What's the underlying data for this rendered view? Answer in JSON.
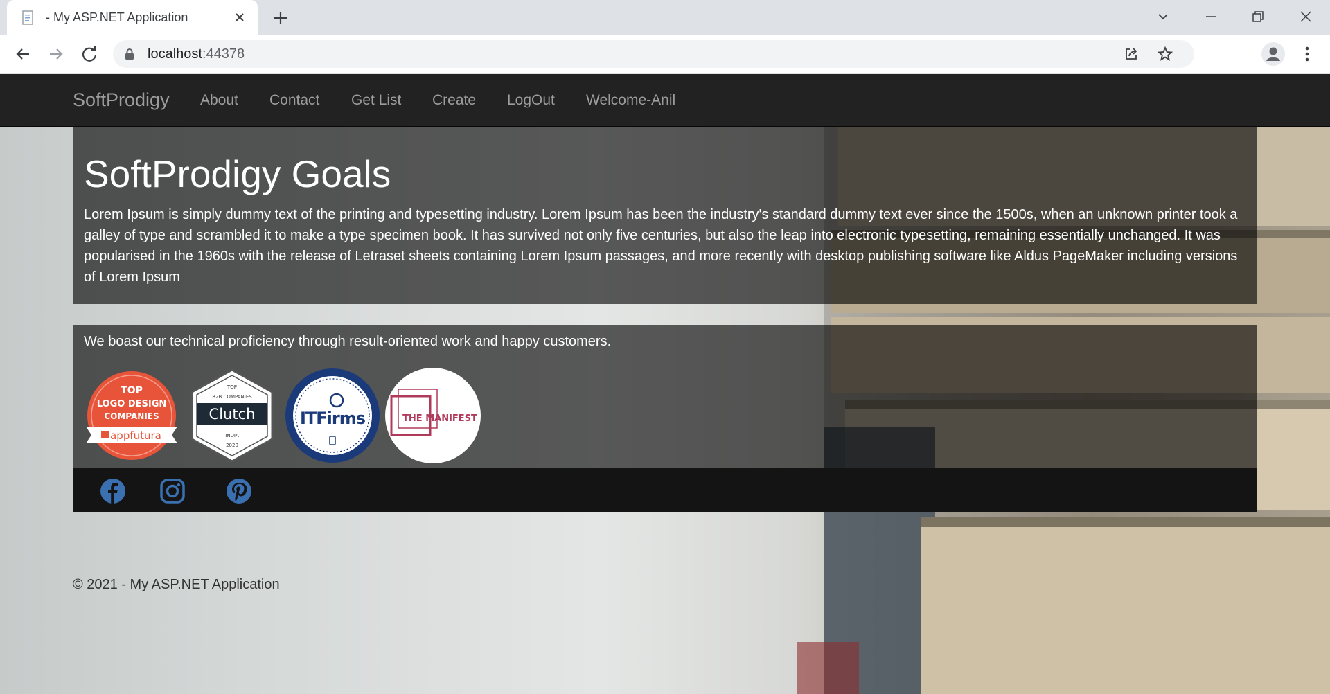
{
  "browser": {
    "tab_title": "- My ASP.NET Application",
    "url_host": "localhost",
    "url_port": ":44378"
  },
  "site": {
    "brand": "SoftProdigy",
    "nav": [
      {
        "label": "About"
      },
      {
        "label": "Contact"
      },
      {
        "label": "Get List"
      },
      {
        "label": "Create"
      },
      {
        "label": "LogOut"
      },
      {
        "label": "Welcome-Anil"
      }
    ]
  },
  "goals": {
    "title": "SoftProdigy Goals",
    "text": "Lorem Ipsum is simply dummy text of the printing and typesetting industry. Lorem Ipsum has been the industry's standard dummy text ever since the 1500s, when an unknown printer took a galley of type and scrambled it to make a type specimen book. It has survived not only five centuries, but also the leap into electronic typesetting, remaining essentially unchanged. It was popularised in the 1960s with the release of Letraset sheets containing Lorem Ipsum passages, and more recently with desktop publishing software like Aldus PageMaker including versions of Lorem Ipsum"
  },
  "awards": {
    "text": "We boast our technical proficiency through result-oriented work and happy customers.",
    "badges": {
      "appfutura": {
        "line1": "TOP",
        "line2": "LOGO DESIGN",
        "line3": "COMPANIES",
        "brand": "appfutura"
      },
      "clutch": {
        "top": "TOP",
        "sub": "B2B COMPANIES",
        "name": "Clutch",
        "region": "INDIA",
        "year": "2020"
      },
      "itfirms": {
        "name": "ITFirms"
      },
      "manifest": {
        "name": "THE MANIFEST"
      }
    }
  },
  "social": [
    "facebook-icon",
    "instagram-icon",
    "pinterest-icon"
  ],
  "footer": {
    "copyright": "© 2021 - My ASP.NET Application"
  },
  "colors": {
    "navbar": "#222222",
    "nav_text": "#9d9d9d",
    "social_icon": "#3a6fb0",
    "appfutura": "#e8543a",
    "itfirms": "#1b3a7a",
    "manifest": "#b03a5b"
  }
}
